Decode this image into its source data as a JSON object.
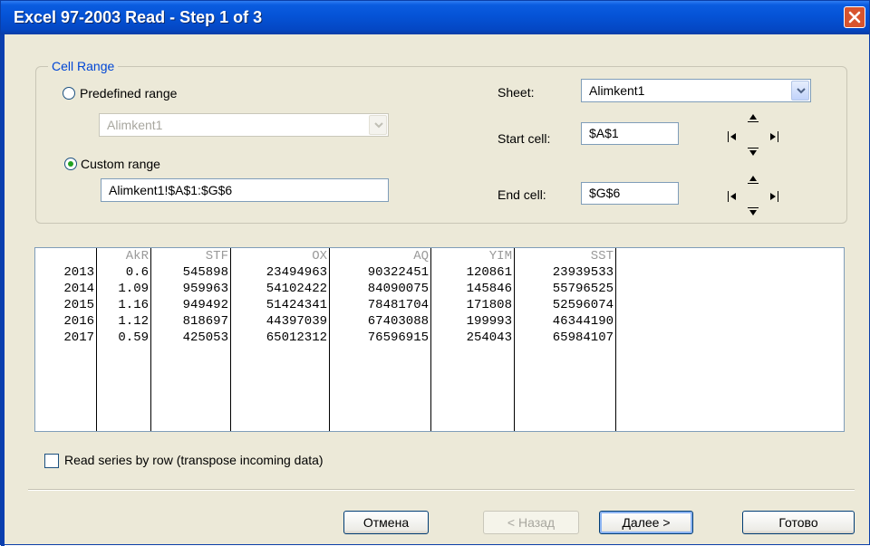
{
  "window": {
    "title": "Excel 97-2003 Read - Step 1 of 3"
  },
  "cell_range": {
    "group_title": "Cell Range",
    "predefined_label": "Predefined range",
    "predefined_value": "Alimkent1",
    "custom_label": "Custom range",
    "custom_value": "Alimkent1!$A$1:$G$6",
    "selected": "custom"
  },
  "sheet": {
    "label": "Sheet:",
    "value": "Alimkent1"
  },
  "start_cell": {
    "label": "Start cell:",
    "value": "$A$1"
  },
  "end_cell": {
    "label": "End cell:",
    "value": "$G$6"
  },
  "preview": {
    "columns": [
      {
        "header": "",
        "cells": [
          "2013",
          "2014",
          "2015",
          "2016",
          "2017"
        ]
      },
      {
        "header": "AkR",
        "cells": [
          "0.6",
          "1.09",
          "1.16",
          "1.12",
          "0.59"
        ]
      },
      {
        "header": "STF",
        "cells": [
          "545898",
          "959963",
          "949492",
          "818697",
          "425053"
        ]
      },
      {
        "header": "OX",
        "cells": [
          "23494963",
          "54102422",
          "51424341",
          "44397039",
          "65012312"
        ]
      },
      {
        "header": "AQ",
        "cells": [
          "90322451",
          "84090075",
          "78481704",
          "67403088",
          "76596915"
        ]
      },
      {
        "header": "YIM",
        "cells": [
          "120861",
          "145846",
          "171808",
          "199993",
          "254043"
        ]
      },
      {
        "header": "SST",
        "cells": [
          "23939533",
          "55796525",
          "52596074",
          "46344190",
          "65984107"
        ]
      }
    ]
  },
  "transpose": {
    "label": "Read series by row (transpose incoming data)",
    "checked": false
  },
  "buttons": {
    "cancel": "Отмена",
    "back": "< Назад",
    "next": "Далее >",
    "finish": "Готово"
  },
  "colors": {
    "title_bar": "#0553d6",
    "dialog_bg": "#ece9d8",
    "group_title": "#0046d5",
    "radio_dot": "#21a121"
  }
}
